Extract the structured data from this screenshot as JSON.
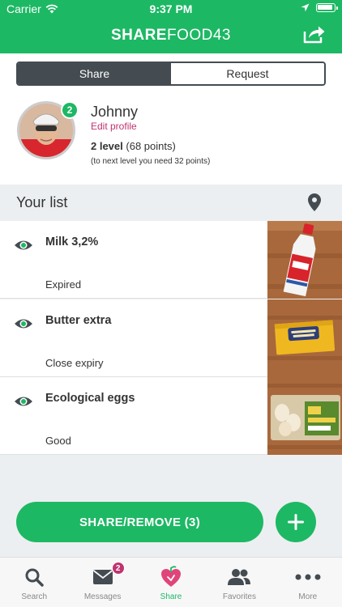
{
  "status_bar": {
    "carrier": "Carrier",
    "time": "9:37 PM"
  },
  "header": {
    "title_bold": "SHARE",
    "title_regular": "FOOD43"
  },
  "segment": {
    "share": "Share",
    "request": "Request"
  },
  "profile": {
    "name": "Johnny",
    "edit_label": "Edit profile",
    "level_label": "2 level",
    "points": "(68 points)",
    "next_level": "(to next level you need 32 points)",
    "badge": "2"
  },
  "list": {
    "title": "Your list",
    "items": [
      {
        "name": "Milk 3,2%",
        "status": "Expired"
      },
      {
        "name": "Butter extra",
        "status": "Close expiry"
      },
      {
        "name": "Ecological eggs",
        "status": "Good"
      }
    ]
  },
  "actions": {
    "share_remove": "SHARE/REMOVE (3)"
  },
  "tabbar": {
    "search": "Search",
    "messages": "Messages",
    "messages_badge": "2",
    "share": "Share",
    "favorites": "Favorites",
    "more": "More"
  },
  "colors": {
    "brand": "#1db864",
    "accent": "#c0336f",
    "dark": "#444c52"
  }
}
